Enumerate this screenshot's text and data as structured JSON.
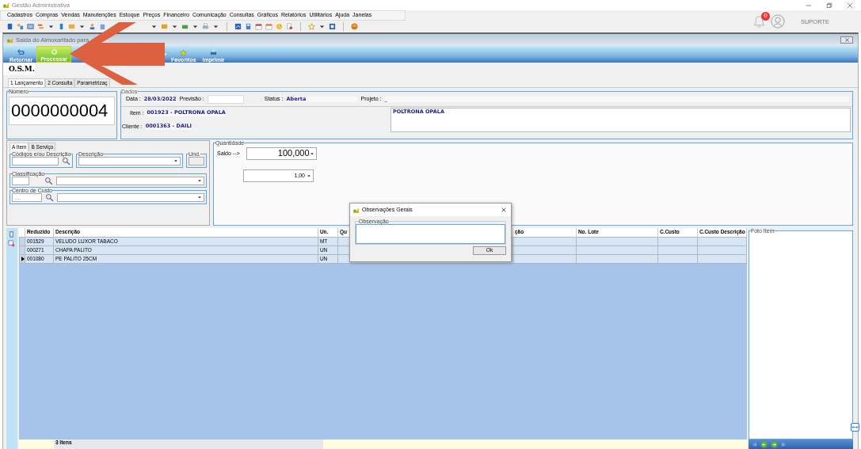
{
  "app": {
    "title": "Gestão Administrativa"
  },
  "menu": [
    "Cadastros",
    "Compras",
    "Vendas",
    "Manutenções",
    "Estoque",
    "Preços",
    "Financeiro",
    "Comunicação",
    "Consultas",
    "Gráficos",
    "Relatórios",
    "Utilitários",
    "Ajuda",
    "Janelas"
  ],
  "notifications": {
    "count": "0"
  },
  "user": {
    "label": "SUPORTE"
  },
  "window": {
    "title": "Saida do Almoxarifado para"
  },
  "ribbon": [
    {
      "label": "Retornar",
      "kind": "undo",
      "highlighted": false
    },
    {
      "label": "Processar",
      "kind": "process",
      "highlighted": true
    },
    {
      "label": "Favoritos",
      "kind": "star",
      "highlighted": false
    },
    {
      "label": "Imprimir",
      "kind": "print",
      "highlighted": false
    }
  ],
  "form_title": "O.S.M.",
  "tabs": [
    {
      "label": "1 Lançamento",
      "selected": true
    },
    {
      "label": "2 Consulta",
      "selected": false
    },
    {
      "label": "Parametrizaç",
      "selected": false
    }
  ],
  "numero": {
    "legend": "Número",
    "value": "0000000004"
  },
  "dados": {
    "legend": "Dados",
    "data_label": "Data :",
    "data": "28/03/2022",
    "previsao_label": "Previsão :",
    "status_label": "Status :",
    "status": "Aberta",
    "projeto_label": "Projeto :",
    "projeto": "_",
    "item_label": "Item :",
    "item": "001923 - POLTRONA OPALA",
    "cliente_label": "Cliente :",
    "cliente": "0001363 - DAILI",
    "descricao": "POLTRONA OPALA"
  },
  "item_panel": {
    "tabs": [
      {
        "label": "A Item",
        "selected": true
      },
      {
        "label": "B Serviço",
        "selected": false
      }
    ],
    "codigos_legend": "Códigos e/ou Descrição",
    "descricao_legend": "Descrição",
    "und_legend": "Und.",
    "classificacao_legend": "Classificação",
    "centro_legend": "Centro de Custo",
    "centro_value": ". ."
  },
  "quantidade": {
    "legend": "Quantidade",
    "saldo_label": "Saldo -->",
    "saldo": "100,000",
    "quantity": "1,00"
  },
  "grid": {
    "columns": [
      "Reduzido",
      "Descrição",
      "Un.",
      "Qu",
      "ção",
      "No. Lote",
      "C.Custo",
      "C.Custo Descrição"
    ],
    "rows": [
      {
        "cells": [
          "001529",
          "VELUDO LUXOR TABACO",
          "MT"
        ],
        "current": false
      },
      {
        "cells": [
          "000271",
          "CHAPA PALITO",
          "UN"
        ],
        "current": false
      },
      {
        "cells": [
          "001080",
          "PE PALITO 25CM",
          "UN"
        ],
        "current": true
      }
    ],
    "footer": "3 Itens"
  },
  "foto": {
    "legend": "Foto Item"
  },
  "dialog": {
    "title": "Observações Gerais",
    "legend": "Observação",
    "button": "Ok"
  }
}
